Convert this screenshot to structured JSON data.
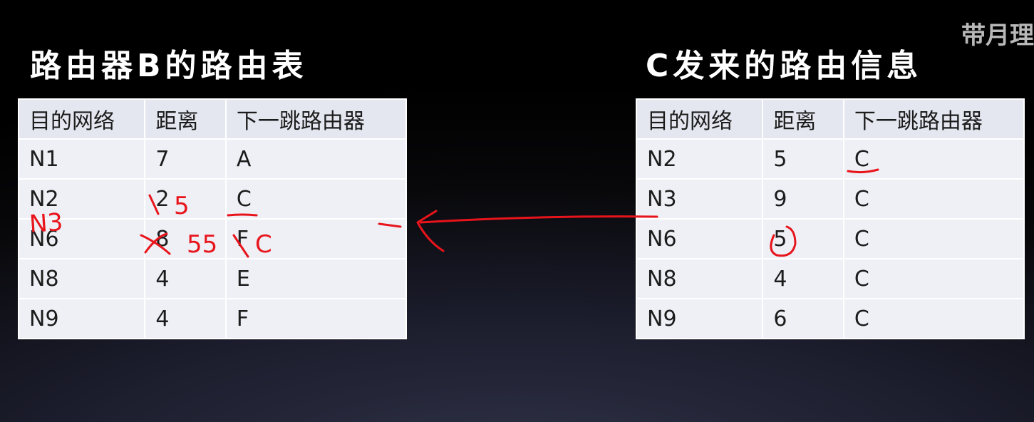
{
  "watermark": "带月理",
  "left": {
    "title": "路由器B的路由表",
    "headers": [
      "目的网络",
      "距离",
      "下一跳路由器"
    ],
    "rows": [
      [
        "N1",
        "7",
        "A"
      ],
      [
        "N2",
        "2",
        "C"
      ],
      [
        "N6",
        "8",
        "F"
      ],
      [
        "N8",
        "4",
        "E"
      ],
      [
        "N9",
        "4",
        "F"
      ]
    ]
  },
  "right": {
    "title": "C发来的路由信息",
    "headers": [
      "目的网络",
      "距离",
      "下一跳路由器"
    ],
    "rows": [
      [
        "N2",
        "5",
        "C"
      ],
      [
        "N3",
        "9",
        "C"
      ],
      [
        "N6",
        "5",
        "C"
      ],
      [
        "N8",
        "4",
        "C"
      ],
      [
        "N9",
        "6",
        "C"
      ]
    ]
  },
  "annotations": {
    "color": "#e8141b",
    "n3_label": "N3",
    "n2_new_distance": "5",
    "n6_new_distance": "55",
    "n6_new_next_hop": "C"
  }
}
